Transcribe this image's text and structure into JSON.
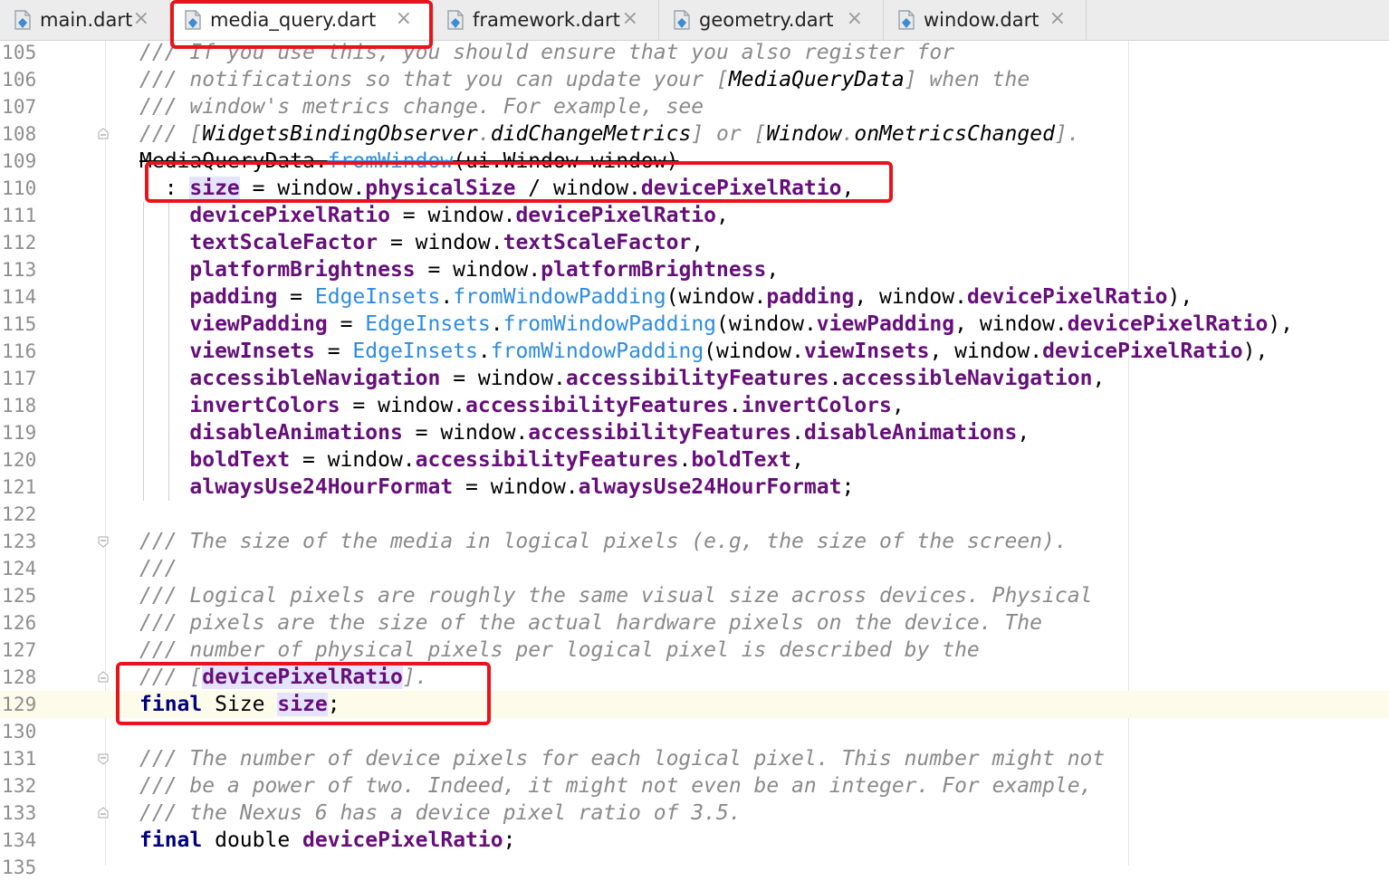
{
  "tabs": [
    {
      "label": "main.dart",
      "close": "×",
      "active": false
    },
    {
      "label": "media_query.dart",
      "close": "×",
      "active": true
    },
    {
      "label": "framework.dart",
      "close": "×",
      "active": false
    },
    {
      "label": "geometry.dart",
      "close": "×",
      "active": false
    },
    {
      "label": "window.dart",
      "close": "×",
      "active": false
    }
  ],
  "editor": {
    "current_line": "129",
    "lines": [
      {
        "n": "105",
        "segs": [
          {
            "t": "/// If you use this, you should ensure that you also register for",
            "c": "cm"
          }
        ]
      },
      {
        "n": "106",
        "segs": [
          {
            "t": "/// notifications so that you can update your [",
            "c": "cm"
          },
          {
            "t": "MediaQueryData",
            "c": "cmref"
          },
          {
            "t": "] when the",
            "c": "cm"
          }
        ]
      },
      {
        "n": "107",
        "segs": [
          {
            "t": "/// window's metrics change. For example, see",
            "c": "cm"
          }
        ]
      },
      {
        "n": "108",
        "segs": [
          {
            "t": "/// [",
            "c": "cm"
          },
          {
            "t": "WidgetsBindingObserver",
            "c": "cmref"
          },
          {
            "t": ".",
            "c": "cm"
          },
          {
            "t": "didChangeMetrics",
            "c": "cmref"
          },
          {
            "t": "] or [",
            "c": "cm"
          },
          {
            "t": "Window",
            "c": "cmref"
          },
          {
            "t": ".",
            "c": "cm"
          },
          {
            "t": "onMetricsChanged",
            "c": "cmref"
          },
          {
            "t": "].",
            "c": "cm"
          }
        ]
      },
      {
        "n": "109",
        "segs": [
          {
            "t": "MediaQueryData.",
            "c": "strike"
          },
          {
            "t": "fromWindow",
            "c": "fn strike"
          },
          {
            "t": "(ui.Window window)",
            "c": "strike"
          }
        ]
      },
      {
        "n": "110",
        "segs": [
          {
            "t": "  : ",
            "c": ""
          },
          {
            "t": "size",
            "c": "fld hl"
          },
          {
            "t": " = window.",
            "c": ""
          },
          {
            "t": "physicalSize",
            "c": "fld"
          },
          {
            "t": " / window.",
            "c": ""
          },
          {
            "t": "devicePixelRatio",
            "c": "fld"
          },
          {
            "t": ",",
            "c": ""
          }
        ]
      },
      {
        "n": "111",
        "segs": [
          {
            "t": "    ",
            "c": ""
          },
          {
            "t": "devicePixelRatio",
            "c": "fld"
          },
          {
            "t": " = window.",
            "c": ""
          },
          {
            "t": "devicePixelRatio",
            "c": "fld"
          },
          {
            "t": ",",
            "c": ""
          }
        ]
      },
      {
        "n": "112",
        "segs": [
          {
            "t": "    ",
            "c": ""
          },
          {
            "t": "textScaleFactor",
            "c": "fld"
          },
          {
            "t": " = window.",
            "c": ""
          },
          {
            "t": "textScaleFactor",
            "c": "fld"
          },
          {
            "t": ",",
            "c": ""
          }
        ]
      },
      {
        "n": "113",
        "segs": [
          {
            "t": "    ",
            "c": ""
          },
          {
            "t": "platformBrightness",
            "c": "fld"
          },
          {
            "t": " = window.",
            "c": ""
          },
          {
            "t": "platformBrightness",
            "c": "fld"
          },
          {
            "t": ",",
            "c": ""
          }
        ]
      },
      {
        "n": "114",
        "segs": [
          {
            "t": "    ",
            "c": ""
          },
          {
            "t": "padding",
            "c": "fld"
          },
          {
            "t": " = ",
            "c": ""
          },
          {
            "t": "EdgeInsets",
            "c": "cls"
          },
          {
            "t": ".",
            "c": ""
          },
          {
            "t": "fromWindowPadding",
            "c": "fn"
          },
          {
            "t": "(window.",
            "c": ""
          },
          {
            "t": "padding",
            "c": "fld"
          },
          {
            "t": ", window.",
            "c": ""
          },
          {
            "t": "devicePixelRatio",
            "c": "fld"
          },
          {
            "t": "),",
            "c": ""
          }
        ]
      },
      {
        "n": "115",
        "segs": [
          {
            "t": "    ",
            "c": ""
          },
          {
            "t": "viewPadding",
            "c": "fld"
          },
          {
            "t": " = ",
            "c": ""
          },
          {
            "t": "EdgeInsets",
            "c": "cls"
          },
          {
            "t": ".",
            "c": ""
          },
          {
            "t": "fromWindowPadding",
            "c": "fn"
          },
          {
            "t": "(window.",
            "c": ""
          },
          {
            "t": "viewPadding",
            "c": "fld"
          },
          {
            "t": ", window.",
            "c": ""
          },
          {
            "t": "devicePixelRatio",
            "c": "fld"
          },
          {
            "t": "),",
            "c": ""
          }
        ]
      },
      {
        "n": "116",
        "segs": [
          {
            "t": "    ",
            "c": ""
          },
          {
            "t": "viewInsets",
            "c": "fld"
          },
          {
            "t": " = ",
            "c": ""
          },
          {
            "t": "EdgeInsets",
            "c": "cls"
          },
          {
            "t": ".",
            "c": ""
          },
          {
            "t": "fromWindowPadding",
            "c": "fn"
          },
          {
            "t": "(window.",
            "c": ""
          },
          {
            "t": "viewInsets",
            "c": "fld"
          },
          {
            "t": ", window.",
            "c": ""
          },
          {
            "t": "devicePixelRatio",
            "c": "fld"
          },
          {
            "t": "),",
            "c": ""
          }
        ]
      },
      {
        "n": "117",
        "segs": [
          {
            "t": "    ",
            "c": ""
          },
          {
            "t": "accessibleNavigation",
            "c": "fld"
          },
          {
            "t": " = window.",
            "c": ""
          },
          {
            "t": "accessibilityFeatures",
            "c": "fld"
          },
          {
            "t": ".",
            "c": ""
          },
          {
            "t": "accessibleNavigation",
            "c": "fld"
          },
          {
            "t": ",",
            "c": ""
          }
        ]
      },
      {
        "n": "118",
        "segs": [
          {
            "t": "    ",
            "c": ""
          },
          {
            "t": "invertColors",
            "c": "fld"
          },
          {
            "t": " = window.",
            "c": ""
          },
          {
            "t": "accessibilityFeatures",
            "c": "fld"
          },
          {
            "t": ".",
            "c": ""
          },
          {
            "t": "invertColors",
            "c": "fld"
          },
          {
            "t": ",",
            "c": ""
          }
        ]
      },
      {
        "n": "119",
        "segs": [
          {
            "t": "    ",
            "c": ""
          },
          {
            "t": "disableAnimations",
            "c": "fld"
          },
          {
            "t": " = window.",
            "c": ""
          },
          {
            "t": "accessibilityFeatures",
            "c": "fld"
          },
          {
            "t": ".",
            "c": ""
          },
          {
            "t": "disableAnimations",
            "c": "fld"
          },
          {
            "t": ",",
            "c": ""
          }
        ]
      },
      {
        "n": "120",
        "segs": [
          {
            "t": "    ",
            "c": ""
          },
          {
            "t": "boldText",
            "c": "fld"
          },
          {
            "t": " = window.",
            "c": ""
          },
          {
            "t": "accessibilityFeatures",
            "c": "fld"
          },
          {
            "t": ".",
            "c": ""
          },
          {
            "t": "boldText",
            "c": "fld"
          },
          {
            "t": ",",
            "c": ""
          }
        ]
      },
      {
        "n": "121",
        "segs": [
          {
            "t": "    ",
            "c": ""
          },
          {
            "t": "alwaysUse24HourFormat",
            "c": "fld"
          },
          {
            "t": " = window.",
            "c": ""
          },
          {
            "t": "alwaysUse24HourFormat",
            "c": "fld"
          },
          {
            "t": ";",
            "c": ""
          }
        ]
      },
      {
        "n": "122",
        "segs": []
      },
      {
        "n": "123",
        "segs": [
          {
            "t": "/// The size of the media in logical pixels (e.g, the size of the screen).",
            "c": "cm"
          }
        ]
      },
      {
        "n": "124",
        "segs": [
          {
            "t": "///",
            "c": "cm"
          }
        ]
      },
      {
        "n": "125",
        "segs": [
          {
            "t": "/// Logical pixels are roughly the same visual size across devices. Physical",
            "c": "cm"
          }
        ]
      },
      {
        "n": "126",
        "segs": [
          {
            "t": "/// pixels are the size of the actual hardware pixels on the device. The",
            "c": "cm"
          }
        ]
      },
      {
        "n": "127",
        "segs": [
          {
            "t": "/// number of physical pixels per logical pixel is described by the",
            "c": "cm"
          }
        ]
      },
      {
        "n": "128",
        "segs": [
          {
            "t": "/// [",
            "c": "cm"
          },
          {
            "t": "devicePixelRatio",
            "c": "fld hl"
          },
          {
            "t": "].",
            "c": "cm"
          }
        ]
      },
      {
        "n": "129",
        "segs": [
          {
            "t": "final",
            "c": "kw"
          },
          {
            "t": " Size ",
            "c": ""
          },
          {
            "t": "size",
            "c": "fld hl"
          },
          {
            "t": ";",
            "c": ""
          }
        ]
      },
      {
        "n": "130",
        "segs": []
      },
      {
        "n": "131",
        "segs": [
          {
            "t": "/// The number of device pixels for each logical pixel. This number might not",
            "c": "cm"
          }
        ]
      },
      {
        "n": "132",
        "segs": [
          {
            "t": "/// be a power of two. Indeed, it might not even be an integer. For example,",
            "c": "cm"
          }
        ]
      },
      {
        "n": "133",
        "segs": [
          {
            "t": "/// the Nexus 6 has a device pixel ratio of 3.5.",
            "c": "cm"
          }
        ]
      },
      {
        "n": "134",
        "segs": [
          {
            "t": "final",
            "c": "kw"
          },
          {
            "t": " double ",
            "c": ""
          },
          {
            "t": "devicePixelRatio",
            "c": "fld"
          },
          {
            "t": ";",
            "c": ""
          }
        ]
      },
      {
        "n": "135",
        "segs": []
      }
    ]
  },
  "colors": {
    "comment": "#8a8a8a",
    "keyword": "#000080",
    "field": "#660e7a",
    "method": "#2e8ce0",
    "annotation_box": "#e8141c",
    "current_line": "#fdfbea"
  }
}
